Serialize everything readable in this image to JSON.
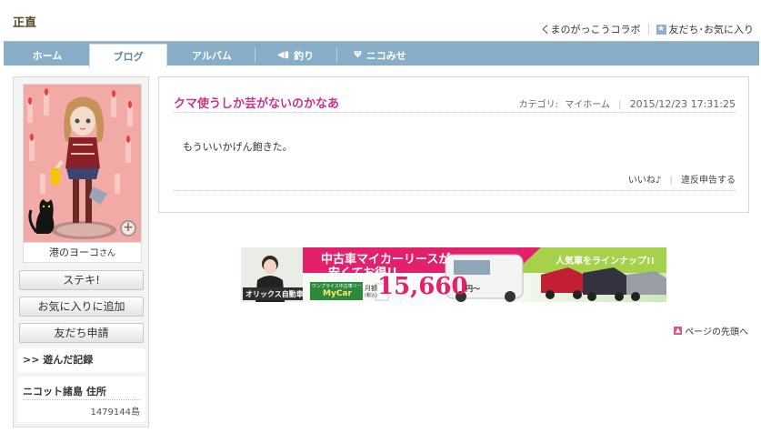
{
  "header": {
    "title": "正直",
    "links": {
      "collab": "くまのがっこうコラボ",
      "friends": "友だち･お気に入り"
    }
  },
  "nav": {
    "tabs": [
      "ホーム",
      "ブログ",
      "アルバム",
      "釣り",
      "ニコみせ"
    ],
    "active_tab": "ブログ"
  },
  "sidebar": {
    "owner_name": "港のヨーコ",
    "owner_suffix": "さん",
    "buttons": {
      "suteki": "ステキ!",
      "favorite": "お気に入りに追加",
      "friend": "友だち申請"
    },
    "played": ">> 遊んだ記録",
    "address_label": "ニコット諸島 住所",
    "address_value": "1479144島"
  },
  "post": {
    "title": "クマ使うしか芸がないのかなあ",
    "category_label": "カテゴリ:",
    "category": "マイホーム",
    "date": "2015/12/23 17:31:25",
    "body": "もういいかげん飽きた。",
    "like": "いいね♪",
    "report": "違反申告する"
  },
  "ad": {
    "headline1": "中古車マイカーリースが",
    "headline2": "安くてお得!!",
    "company": "オリックス自動車",
    "brand_top": "ワンプライス中古車リース",
    "brand": "MyCar",
    "price_prefix": "月額",
    "price_unit": "(税込)",
    "price": "15,660",
    "yen": "円〜",
    "lineup": "人気車をラインナップ!!"
  },
  "footer": {
    "page_top": "ページの先頭へ"
  },
  "colors": {
    "nav": "#87aec6",
    "title": "#cc3388",
    "avatar_bg": "#f1aaa5"
  }
}
